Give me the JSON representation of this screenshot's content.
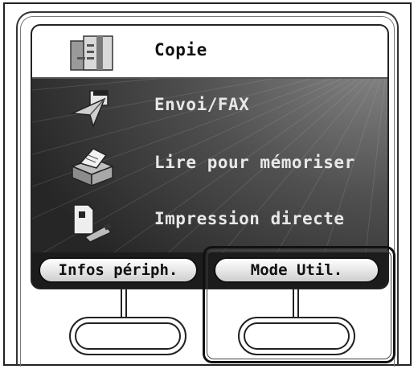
{
  "menu": {
    "items": [
      {
        "label": "Copie",
        "icon": "copy-icon",
        "selected": true
      },
      {
        "label": "Envoi/FAX",
        "icon": "send-fax-icon",
        "selected": false
      },
      {
        "label": "Lire pour mémoriser",
        "icon": "scan-to-memory-icon",
        "selected": false
      },
      {
        "label": "Impression directe",
        "icon": "direct-print-icon",
        "selected": false
      }
    ]
  },
  "softkeys": {
    "left_label": "Infos périph.",
    "right_label": "Mode Util."
  },
  "colors": {
    "screen_background": "#3a3a3a",
    "selected_row": "#ffffff",
    "softkey_bar": "#1c1c1c"
  }
}
